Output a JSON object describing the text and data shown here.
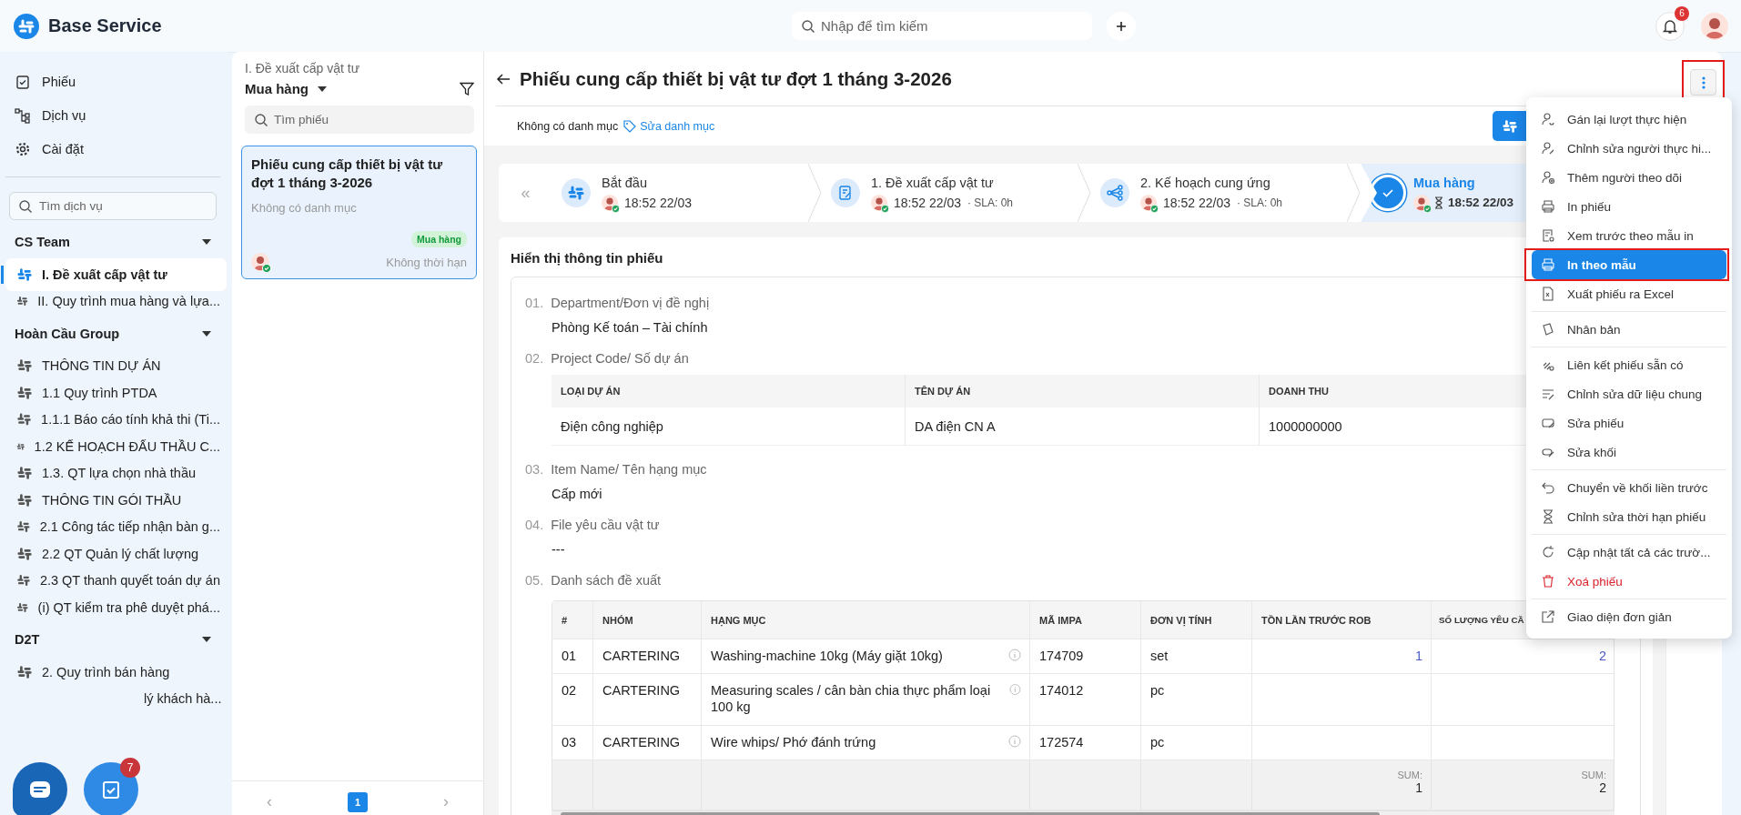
{
  "app": {
    "name": "Base Service"
  },
  "topbar": {
    "search_placeholder": "Nhập để tìm kiếm",
    "notification_count": "6"
  },
  "sidebar": {
    "nav": [
      {
        "label": "Phiếu"
      },
      {
        "label": "Dịch vụ"
      },
      {
        "label": "Cài đặt"
      }
    ],
    "search_placeholder": "Tìm dịch vụ",
    "groups": [
      {
        "title": "CS Team",
        "expanded": true,
        "items": [
          {
            "label": "I. Đề xuất cấp vật tư",
            "selected": true
          },
          {
            "label": "II. Quy trình mua hàng và lựa...",
            "selected": false
          }
        ]
      },
      {
        "title": "Hoàn Cầu Group",
        "expanded": true,
        "items": [
          {
            "label": "THÔNG TIN DỰ ÁN",
            "selected": false
          },
          {
            "label": "1.1 Quy trình PTDA",
            "selected": false
          },
          {
            "label": "1.1.1 Báo cáo tính khả thi (Ti...",
            "selected": false
          },
          {
            "label": "1.2 KẾ HOẠCH ĐẤU THẦU C...",
            "selected": false
          },
          {
            "label": "1.3. QT lựa chọn nhà thầu",
            "selected": false
          },
          {
            "label": "THÔNG TIN GÓI THẦU",
            "selected": false
          },
          {
            "label": "2.1 Công tác tiếp nhận bàn g...",
            "selected": false
          },
          {
            "label": "2.2 QT Quản lý chất lượng",
            "selected": false
          },
          {
            "label": "2.3 QT thanh quyết toán dự án",
            "selected": false
          },
          {
            "label": "(i) QT kiểm tra phê duyệt phá...",
            "selected": false
          }
        ]
      },
      {
        "title": "D2T",
        "expanded": true,
        "items": [
          {
            "label": "2. Quy trình bán hàng",
            "selected": false
          },
          {
            "label": "lý khách hà...",
            "selected": false,
            "kind": "covered"
          }
        ]
      }
    ]
  },
  "list_panel": {
    "breadcrumb": "I. Đề xuất cấp vật tư",
    "filter": "Mua hàng",
    "search_placeholder": "Tìm phiếu",
    "tickets": [
      {
        "title": "Phiếu cung cấp thiết bị vật tư đợt 1 tháng 3-2026",
        "category": "Không có danh mục",
        "stage": "Mua hàng",
        "deadline": "Không thời hạn",
        "selected": true
      }
    ],
    "prev": "‹",
    "next": "›",
    "pages": [
      {
        "label": "1",
        "selected": true
      }
    ]
  },
  "detail": {
    "title": "Phiếu cung cấp thiết bị vật tư đợt 1 tháng 3-2026",
    "category": "Không có danh mục",
    "edit_category": "Sửa danh mục",
    "menu_annotated": true,
    "collapse": "«",
    "steps": [
      {
        "name": "Bắt đầu",
        "time": "18:52 22/03",
        "selected": false
      },
      {
        "name": "1. Đề xuất cấp vật tư",
        "time": "18:52 22/03",
        "sla": "· SLA: 0h",
        "selected": false
      },
      {
        "name": "2. Kế hoạch cung ứng",
        "time": "18:52 22/03",
        "sla": "· SLA: 0h",
        "selected": false
      },
      {
        "name": "Mua hàng",
        "time": "18:52 22/03",
        "selected": true
      }
    ],
    "form": {
      "title": "Hiển thị thông tin phiếu",
      "fields": [
        {
          "number": "01.",
          "label": "Department/Đơn vị đề nghị",
          "kind": "text",
          "value": "Phòng Kế toán – Tài chính"
        },
        {
          "number": "02.",
          "label": "Project Code/ Số dự án",
          "kind": "project",
          "columns": [
            "LOẠI DỰ ÁN",
            "TÊN DỰ ÁN",
            "DOANH THU"
          ],
          "rows": [
            [
              "Điện công nghiệp",
              "DA điện CN A",
              "1000000000"
            ]
          ]
        },
        {
          "number": "03.",
          "label": "Item Name/ Tên hạng mục",
          "kind": "text",
          "value": "Cấp mới"
        },
        {
          "number": "04.",
          "label": "File yêu cầu vật tư",
          "kind": "text",
          "value": "---"
        },
        {
          "number": "05.",
          "label": "Danh sách đề xuất",
          "kind": "items",
          "columns": [
            "#",
            "NHÓM",
            "HẠNG MỤC",
            "MÃ IMPA",
            "ĐƠN VỊ TÍNH",
            "TỒN LẦN TRƯỚC ROB",
            "SỐ LƯỢNG YÊU CẦ"
          ],
          "rows": [
            {
              "no": "01",
              "group": "CARTERING",
              "item": "Washing-machine 10kg (Máy giặt 10kg)",
              "impa": "174709",
              "unit": "set",
              "rob": "1",
              "qty": "2"
            },
            {
              "no": "02",
              "group": "CARTERING",
              "item": "Measuring scales / cân bàn chia thực phẩm loại 100 kg",
              "impa": "174012",
              "unit": "pc"
            },
            {
              "no": "03",
              "group": "CARTERING",
              "item": "Wire whips/ Phớ đánh trứng",
              "impa": "172574",
              "unit": "pc"
            }
          ],
          "sums": [
            {
              "label": "SUM:",
              "value": "1"
            },
            {
              "label": "SUM:",
              "value": "2"
            }
          ]
        }
      ]
    }
  },
  "menu": {
    "groups": [
      [
        {
          "label": "Gán lại lượt thực hiện",
          "selected": false
        },
        {
          "label": "Chỉnh sửa người thực hi...",
          "selected": false
        },
        {
          "label": "Thêm người theo dõi",
          "selected": false
        },
        {
          "label": "In phiếu",
          "selected": false
        },
        {
          "label": "Xem trước theo mẫu in",
          "selected": false
        },
        {
          "label": "In theo mẫu",
          "selected": true,
          "annotated": true
        },
        {
          "label": "Xuất phiếu ra Excel",
          "selected": false
        }
      ],
      [
        {
          "label": "Nhân bản",
          "selected": false
        }
      ],
      [
        {
          "label": "Liên kết phiếu sẵn có",
          "selected": false
        },
        {
          "label": "Chỉnh sửa dữ liệu chung",
          "selected": false
        },
        {
          "label": "Sửa phiếu",
          "selected": false
        },
        {
          "label": "Sửa khối",
          "selected": false
        }
      ],
      [
        {
          "label": "Chuyển về khối liền trước",
          "selected": false
        },
        {
          "label": "Chỉnh sửa thời hạn phiếu",
          "selected": false
        }
      ],
      [
        {
          "label": "Cập nhật tất cả các trườ...",
          "selected": false
        },
        {
          "label": "Xoá phiếu",
          "selected": false,
          "kind": "danger"
        }
      ],
      [
        {
          "label": "Giao diện đơn giản",
          "selected": false
        }
      ]
    ]
  },
  "fab": {
    "task_count": "7"
  }
}
